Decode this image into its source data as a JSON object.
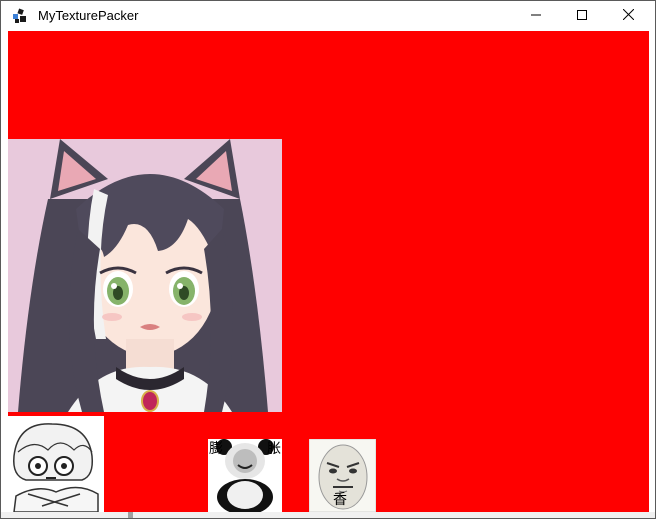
{
  "window": {
    "title": "MyTexturePacker",
    "app_icon": "puzzle-app-icon",
    "controls": [
      "minimize-icon",
      "maximize-icon",
      "close-icon"
    ]
  },
  "canvas": {
    "background_color": "#ff0000"
  },
  "sprites": [
    {
      "name": "anime-catgirl-portrait",
      "caption": ""
    },
    {
      "name": "chibi-character",
      "caption": ""
    },
    {
      "name": "panda-meme",
      "caption_left": "膨",
      "caption_right": "胀"
    },
    {
      "name": "rage-face-meme",
      "caption": "香"
    }
  ]
}
